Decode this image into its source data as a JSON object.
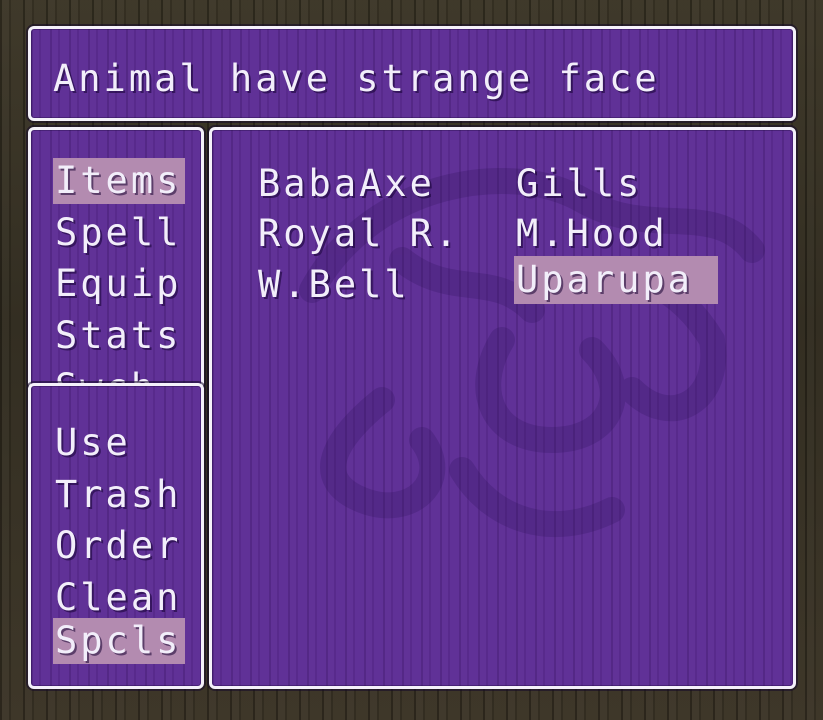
{
  "message": {
    "text": "Animal have strange face"
  },
  "command_menu": {
    "items": [
      {
        "label": "Items",
        "selected": true
      },
      {
        "label": "Spell",
        "selected": false
      },
      {
        "label": "Equip",
        "selected": false
      },
      {
        "label": "Stats",
        "selected": false
      },
      {
        "label": "Swch",
        "selected": false
      }
    ]
  },
  "action_menu": {
    "items": [
      {
        "label": "Use",
        "selected": false
      },
      {
        "label": "Trash",
        "selected": false
      },
      {
        "label": "Order",
        "selected": false
      },
      {
        "label": "Clean",
        "selected": false
      },
      {
        "label": "Spcls",
        "selected": true
      }
    ]
  },
  "inventory": {
    "items": [
      {
        "label": "BabaAxe",
        "selected": false
      },
      {
        "label": "Gills",
        "selected": false
      },
      {
        "label": "Royal R.",
        "selected": false
      },
      {
        "label": "M.Hood",
        "selected": false
      },
      {
        "label": "W.Bell",
        "selected": false
      },
      {
        "label": "Uparupa",
        "selected": true
      }
    ]
  },
  "colors": {
    "window_fill": "#5d2d95",
    "window_border": "#f4f1fa",
    "highlight": "#b38bb0",
    "text": "#f2eefa",
    "background_wood": "#332d21"
  },
  "icons": {
    "emblem": "dragon-emblem"
  }
}
